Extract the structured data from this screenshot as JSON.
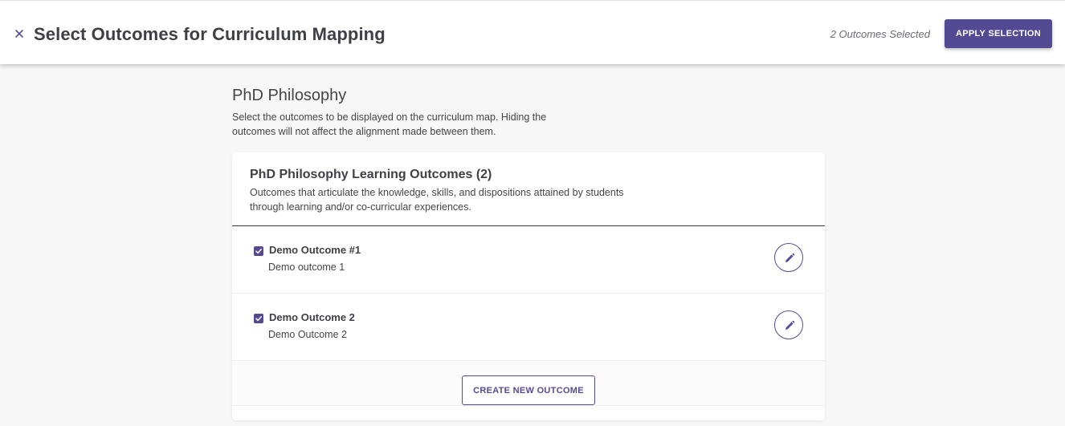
{
  "header": {
    "title": "Select Outcomes for Curriculum Mapping",
    "selected_count": "2 Outcomes Selected",
    "apply_label": "APPLY SELECTION",
    "close_icon": "close-icon"
  },
  "program": {
    "title": "PhD Philosophy",
    "description": "Select the outcomes to be displayed on the curriculum map. Hiding the outcomes will not affect the alignment made between them."
  },
  "outcome_set": {
    "title": "PhD Philosophy Learning Outcomes (2)",
    "description": "Outcomes that articulate the knowledge, skills, and dispositions attained by students through learning and/or co-curricular experiences.",
    "outcomes": [
      {
        "name": "Demo Outcome #1",
        "description": "Demo outcome 1",
        "checked": true,
        "edit_icon": "pencil-icon"
      },
      {
        "name": "Demo Outcome 2",
        "description": "Demo Outcome 2",
        "checked": true,
        "edit_icon": "pencil-icon"
      }
    ],
    "create_label": "CREATE NEW OUTCOME"
  },
  "colors": {
    "accent": "#544a94",
    "background": "#f7f7f7",
    "text": "#3f3f46"
  }
}
